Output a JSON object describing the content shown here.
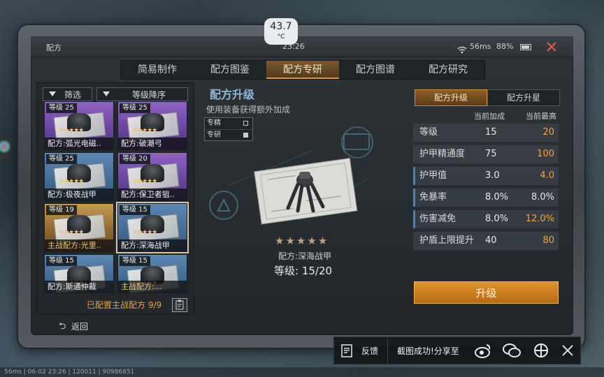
{
  "overlay": {
    "temperature": "43.7",
    "temperature_unit": "°C"
  },
  "status_bar": {
    "title": "配方",
    "time": "23:26",
    "ping": "56ms",
    "battery": "88%"
  },
  "tabs": [
    {
      "label": "简易制作",
      "active": false
    },
    {
      "label": "配方图鉴",
      "active": false
    },
    {
      "label": "配方专研",
      "active": true
    },
    {
      "label": "配方图谱",
      "active": false
    },
    {
      "label": "配方研究",
      "active": false
    }
  ],
  "filters": {
    "filter_label": "筛选",
    "sort_label": "等级降序"
  },
  "cards": [
    {
      "level": "等级 25",
      "name": "配方:弧光电磁..",
      "color": "purple",
      "selected": false,
      "highlight": false
    },
    {
      "level": "等级 25",
      "name": "配方:破潮弓",
      "color": "purple",
      "selected": false,
      "highlight": false
    },
    {
      "level": "等级 25",
      "name": "配方:极夜战甲",
      "color": "blue",
      "selected": false,
      "highlight": false
    },
    {
      "level": "等级 20",
      "name": "配方:保卫者狙..",
      "color": "purple",
      "selected": false,
      "highlight": false
    },
    {
      "level": "等级 19",
      "name": "主战配方:光里..",
      "color": "gold",
      "selected": false,
      "highlight": true
    },
    {
      "level": "等级 15",
      "name": "配方:深海战甲",
      "color": "blue",
      "selected": true,
      "highlight": false
    },
    {
      "level": "等级 15",
      "name": "配方:斯通仲裁",
      "color": "blue",
      "selected": false,
      "highlight": false
    },
    {
      "level": "等级 15",
      "name": "主战配方:...",
      "color": "blue",
      "selected": false,
      "highlight": true
    }
  ],
  "left_footer": {
    "configured": "已配置主战配方 9/9"
  },
  "detail": {
    "title": "配方升级",
    "subtitle": "使用装备获得额外加成",
    "legend": [
      {
        "label": "专精",
        "checked": false
      },
      {
        "label": "专研",
        "checked": true
      }
    ],
    "item_name": "配方:深海战甲",
    "level_text": "等级:  15/20",
    "stars_filled": 0,
    "stars_total": 5
  },
  "right": {
    "segment_a": "配方升级",
    "segment_b": "配方升星",
    "col_current": "当前加成",
    "col_max": "当前最高",
    "stats": [
      {
        "name": "等级",
        "current": "15",
        "max": "20",
        "up": true,
        "hl": false
      },
      {
        "name": "护甲精通度",
        "current": "75",
        "max": "100",
        "up": true,
        "hl": false
      },
      {
        "name": "护甲值",
        "current": "3.0",
        "max": "4.0",
        "up": true,
        "hl": true
      },
      {
        "name": "免暴率",
        "current": "8.0%",
        "max": "8.0%",
        "up": false,
        "hl": true
      },
      {
        "name": "伤害减免",
        "current": "8.0%",
        "max": "12.0%",
        "up": true,
        "hl": true
      },
      {
        "name": "护盾上限提升",
        "current": "40",
        "max": "80",
        "up": true,
        "hl": false
      }
    ],
    "upgrade_label": "升级"
  },
  "bottom": {
    "back_label": "返回",
    "feedback_label": "反馈",
    "share_text": "截图成功!分享至"
  },
  "footer_stamp": "56ms | 06-02 23:26 | 120011 | 90986851"
}
